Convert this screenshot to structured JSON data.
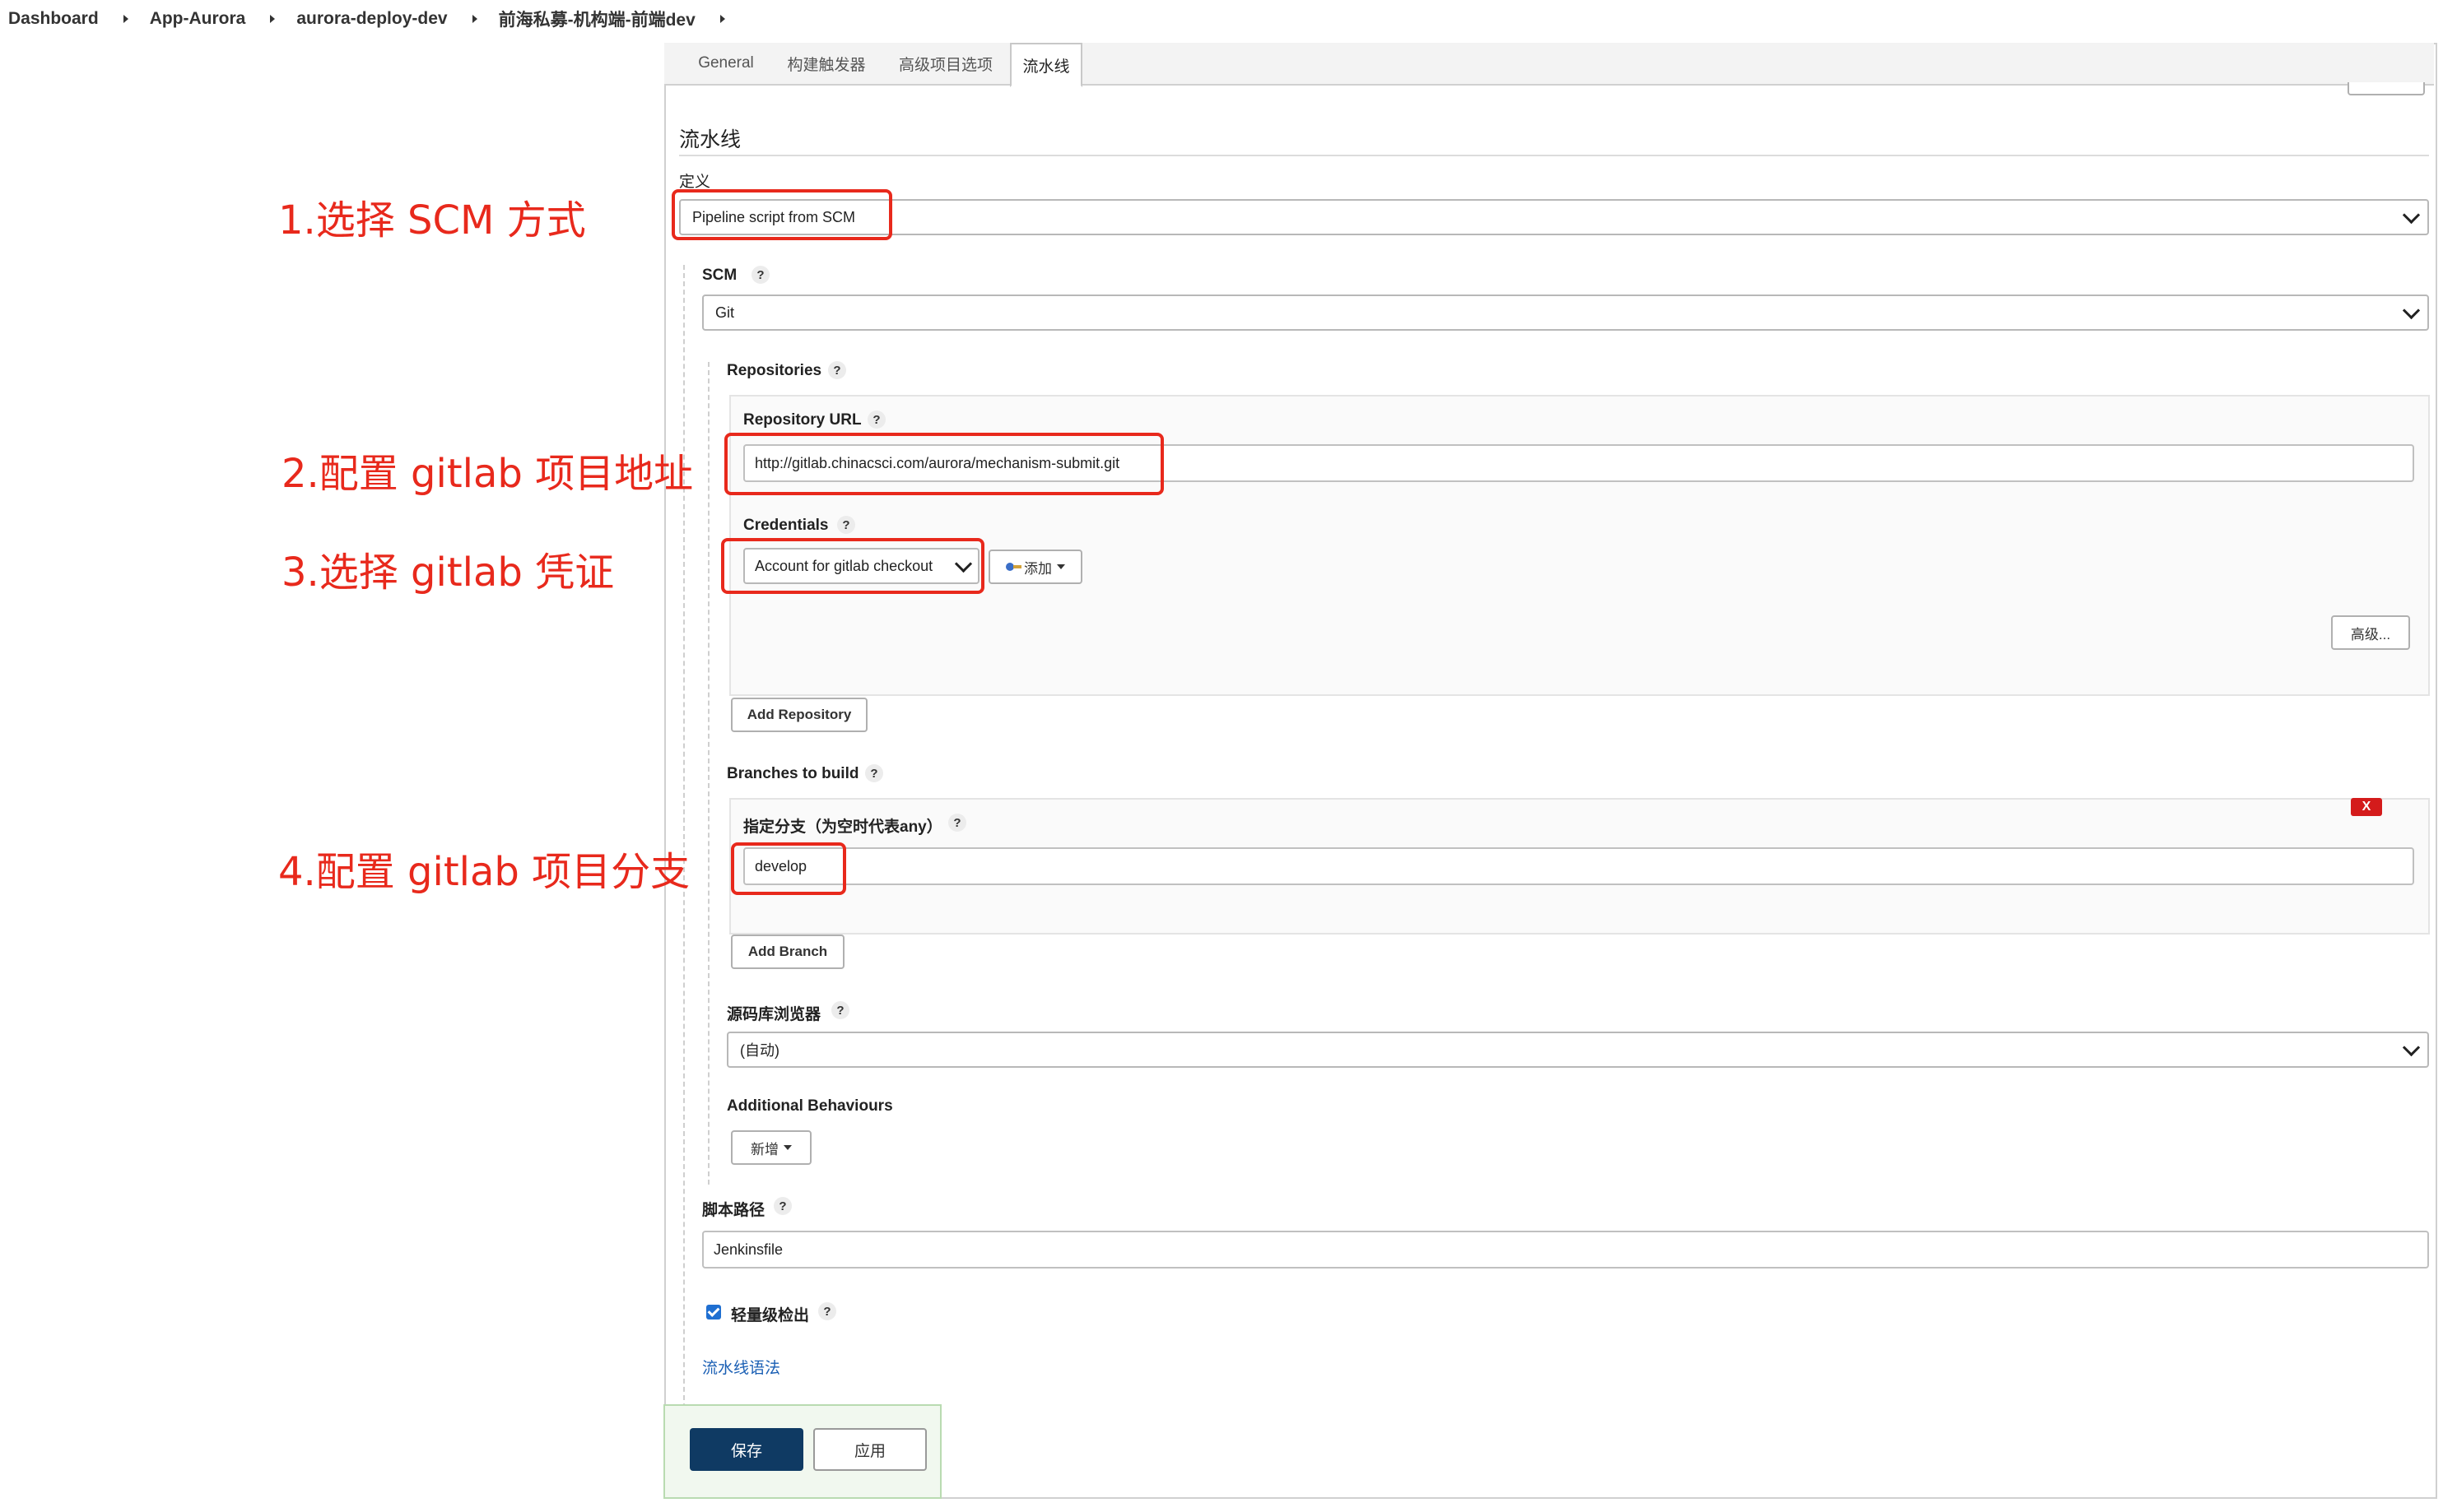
{
  "breadcrumb": [
    "Dashboard",
    "App-Aurora",
    "aurora-deploy-dev",
    "前海私募-机构端-前端dev"
  ],
  "tabs": [
    "General",
    "构建触发器",
    "高级项目选项",
    "流水线"
  ],
  "section_title": "流水线",
  "definition": {
    "label": "定义",
    "value": "Pipeline script from SCM"
  },
  "scm": {
    "label": "SCM",
    "value": "Git"
  },
  "repositories": {
    "label": "Repositories",
    "url_label": "Repository URL",
    "url_value": "http://gitlab.chinacsci.com/aurora/mechanism-submit.git",
    "credentials_label": "Credentials",
    "credentials_value": "Account for gitlab checkout",
    "add_label": "添加",
    "advanced_label": "高级...",
    "add_repository_label": "Add Repository"
  },
  "branches": {
    "label": "Branches to build",
    "branch_label": "指定分支（为空时代表any）",
    "branch_value": "develop",
    "remove_label": "X",
    "add_branch_label": "Add Branch"
  },
  "browser": {
    "label": "源码库浏览器",
    "value": "(自动)"
  },
  "behaviours": {
    "label": "Additional Behaviours",
    "add_label": "新增"
  },
  "script_path": {
    "label": "脚本路径",
    "value": "Jenkinsfile"
  },
  "lightweight": {
    "label": "轻量级检出",
    "checked": true
  },
  "syntax_link": "流水线语法",
  "footer": {
    "save_label": "保存",
    "apply_label": "应用"
  },
  "annotations": {
    "step1": "1.选择 SCM 方式",
    "step2": "2.配置 gitlab 项目地址",
    "step3": "3.选择 gitlab 凭证",
    "step4": "4.配置 gitlab 项目分支"
  },
  "colors": {
    "annotation_red": "#e8291c",
    "save_button": "#0f3a63",
    "link_blue": "#1a5fb4"
  }
}
